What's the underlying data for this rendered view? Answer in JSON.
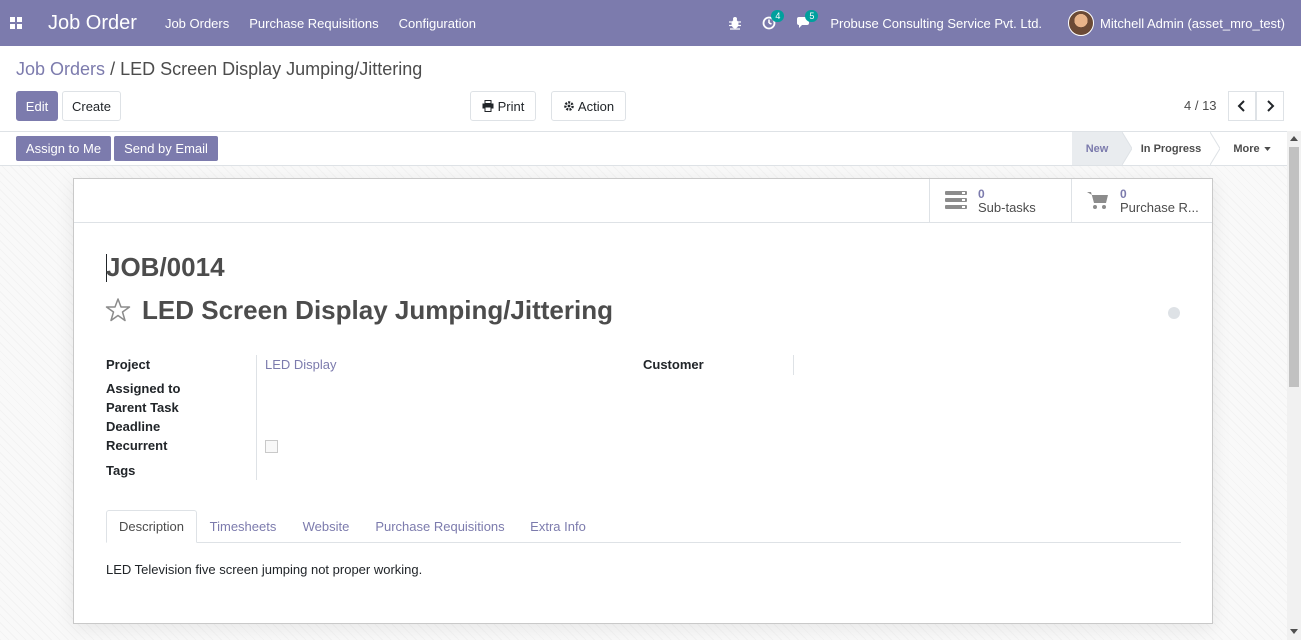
{
  "navbar": {
    "app_name": "Job Order",
    "menu": [
      "Job Orders",
      "Purchase Requisitions",
      "Configuration"
    ],
    "activity_count": "4",
    "message_count": "5",
    "company": "Probuse Consulting Service Pvt. Ltd.",
    "user": "Mitchell Admin (asset_mro_test)"
  },
  "breadcrumb": {
    "parent": "Job Orders",
    "separator": "/",
    "current": "LED Screen Display Jumping/Jittering"
  },
  "toolbar": {
    "edit": "Edit",
    "create": "Create",
    "print": "Print",
    "action": "Action"
  },
  "pager": {
    "value": "4 / 13"
  },
  "statusbar": {
    "assign_to_me": "Assign to Me",
    "send_by_email": "Send by Email",
    "stages": [
      "New",
      "In Progress"
    ],
    "more": "More"
  },
  "stat_buttons": [
    {
      "value": "0",
      "label": "Sub-tasks"
    },
    {
      "value": "0",
      "label": "Purchase R..."
    }
  ],
  "record": {
    "reference": "JOB/0014",
    "title": "LED Screen Display Jumping/Jittering"
  },
  "fields": {
    "project_label": "Project",
    "project_value": "LED Display",
    "customer_label": "Customer",
    "assigned_to_label": "Assigned to",
    "parent_task_label": "Parent Task",
    "deadline_label": "Deadline",
    "recurrent_label": "Recurrent",
    "tags_label": "Tags"
  },
  "tabs": [
    "Description",
    "Timesheets",
    "Website",
    "Purchase Requisitions",
    "Extra Info"
  ],
  "description": "LED Television five screen jumping not proper working.",
  "colors": {
    "primary": "#7c7bad",
    "accent": "#00a09d"
  }
}
